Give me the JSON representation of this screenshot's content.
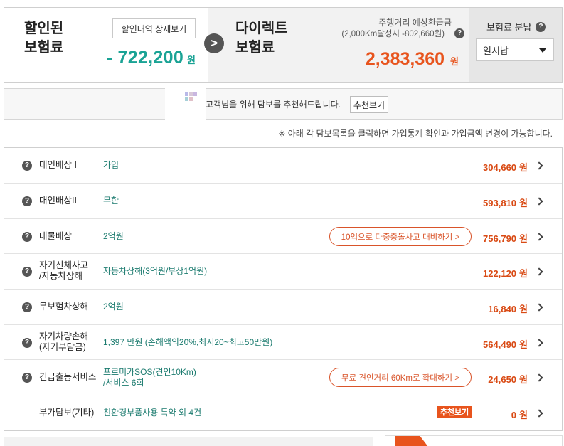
{
  "summary": {
    "discounted_title_line1": "할인된",
    "discounted_title_line2": "보험료",
    "detail_button": "할인내역 상세보기",
    "discount_amount": "- 722,200",
    "discount_unit": "원",
    "arrow_symbol": ">",
    "direct_title_line1": "다이렉트",
    "direct_title_line2": "보험료",
    "refund_label_line1": "주행거리 예상환급금",
    "refund_label_line2": "(2,000Km달성시 -802,660원)",
    "direct_amount": "2,383,360",
    "direct_unit": "원",
    "payment_label": "보험료 분납",
    "payment_selected": "일시납"
  },
  "recommendation": {
    "text": "고객님을 위해 담보를 추천해드립니다.",
    "button": "추천보기"
  },
  "notice": "※ 아래 각 담보목록을 클릭하면 가입통계 확인과 가입금액 변경이 가능합니다.",
  "coverages": [
    {
      "name_line1": "대인배상 I",
      "name_line2": "",
      "value_line1": "가입",
      "value_line2": "",
      "promo": "",
      "badge": "",
      "price": "304,660",
      "unit": "원",
      "has_help": true
    },
    {
      "name_line1": "대인배상II",
      "name_line2": "",
      "value_line1": "무한",
      "value_line2": "",
      "promo": "",
      "badge": "",
      "price": "593,810",
      "unit": "원",
      "has_help": true
    },
    {
      "name_line1": "대물배상",
      "name_line2": "",
      "value_line1": "2억원",
      "value_line2": "",
      "promo": "10억으로 다중충돌사고 대비하기 >",
      "badge": "",
      "price": "756,790",
      "unit": "원",
      "has_help": true
    },
    {
      "name_line1": "자기신체사고",
      "name_line2": "/자동차상해",
      "value_line1": "자동차상해(3억원/부상1억원)",
      "value_line2": "",
      "promo": "",
      "badge": "",
      "price": "122,120",
      "unit": "원",
      "has_help": true
    },
    {
      "name_line1": "무보험차상해",
      "name_line2": "",
      "value_line1": "2억원",
      "value_line2": "",
      "promo": "",
      "badge": "",
      "price": "16,840",
      "unit": "원",
      "has_help": true
    },
    {
      "name_line1": "자기차량손해",
      "name_line2": "(자기부담금)",
      "value_line1": "1,397 만원 (손해액의20%,최저20~최고50만원)",
      "value_line2": "",
      "promo": "",
      "badge": "",
      "price": "564,490",
      "unit": "원",
      "has_help": true
    },
    {
      "name_line1": "긴급출동서비스",
      "name_line2": "",
      "value_line1": "프로미카SOS(견인10Km)",
      "value_line2": "/서비스 6회",
      "promo": "무료 견인거리 60Km로 확대하기 >",
      "badge": "",
      "price": "24,650",
      "unit": "원",
      "has_help": true
    },
    {
      "name_line1": "부가담보(기타)",
      "name_line2": "",
      "value_line1": "친환경부품사용 특약 외 4건",
      "value_line2": "",
      "promo": "",
      "badge": "추천보기",
      "price": "0",
      "unit": "원",
      "has_help": false
    }
  ],
  "colors": {
    "discount": "#1aa395",
    "direct": "#e8541d",
    "price": "#d94a14",
    "value": "#1a7a6e"
  }
}
